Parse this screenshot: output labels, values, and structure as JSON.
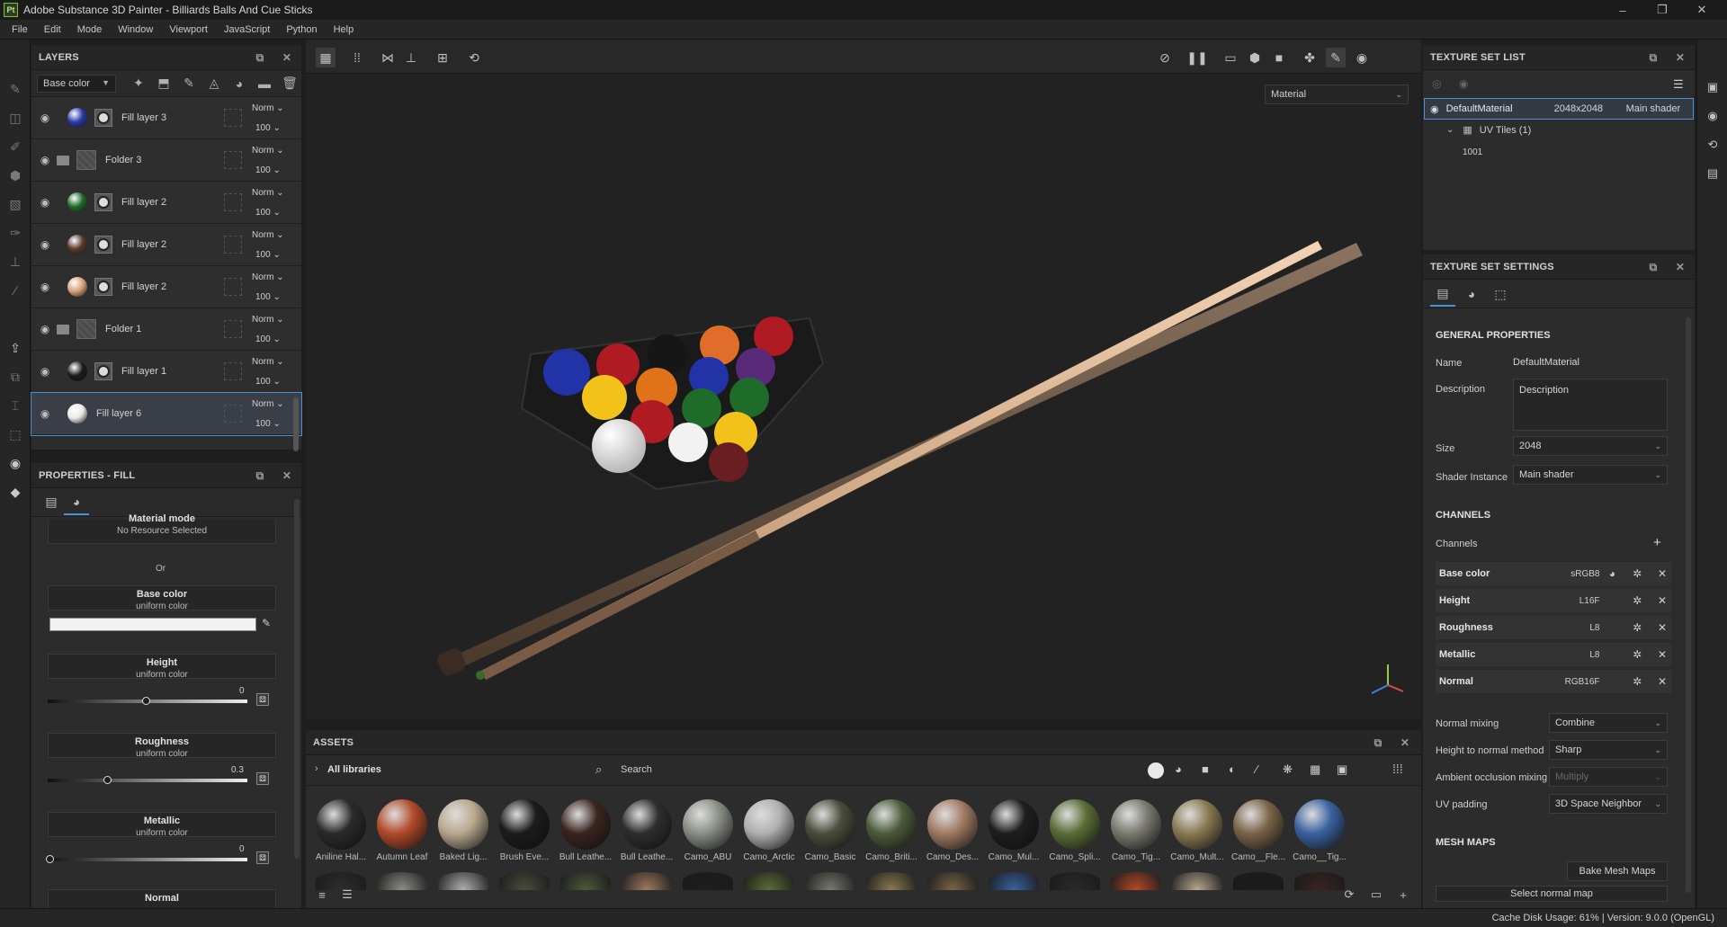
{
  "window": {
    "title": "Adobe Substance 3D Painter - Billiards Balls And Cue Sticks",
    "logo": "Pt",
    "minimize": "–",
    "maximize": "❐",
    "close": "✕"
  },
  "menu": [
    "File",
    "Edit",
    "Mode",
    "Window",
    "Viewport",
    "JavaScript",
    "Python",
    "Help"
  ],
  "layers": {
    "title": "LAYERS",
    "channel": "Base color",
    "items": [
      {
        "name": "Fill layer 3",
        "kind": "fill",
        "color": "#2a3aa8",
        "blend": "Norm",
        "opacity": "100"
      },
      {
        "name": "Folder 3",
        "kind": "folder",
        "blend": "Norm",
        "opacity": "100"
      },
      {
        "name": "Fill layer 2",
        "kind": "fill",
        "color": "#1e6b2a",
        "blend": "Norm",
        "opacity": "100"
      },
      {
        "name": "Fill layer 2",
        "kind": "fill",
        "color": "#5a3a2c",
        "blend": "Norm",
        "opacity": "100"
      },
      {
        "name": "Fill layer 2",
        "kind": "fill",
        "color": "#d8a27a",
        "blend": "Norm",
        "opacity": "100"
      },
      {
        "name": "Folder 1",
        "kind": "folder",
        "blend": "Norm",
        "opacity": "100"
      },
      {
        "name": "Fill layer 1",
        "kind": "fill",
        "color": "#1a1a1a",
        "blend": "Norm",
        "opacity": "100"
      },
      {
        "name": "Fill layer 6",
        "kind": "fill-nomask",
        "color": "#e8e8e8",
        "blend": "Norm",
        "opacity": "100",
        "selected": true
      }
    ]
  },
  "properties": {
    "title": "PROPERTIES - FILL",
    "material_mode_title": "Material mode",
    "material_mode_sub": "No Resource Selected",
    "or": "Or",
    "base_color_title": "Base color",
    "base_color_sub": "uniform color",
    "height_title": "Height",
    "height_sub": "uniform color",
    "height_value": "0",
    "roughness_title": "Roughness",
    "roughness_sub": "uniform color",
    "roughness_value": "0.3",
    "metallic_title": "Metallic",
    "metallic_sub": "uniform color",
    "metallic_value": "0",
    "normal_title": "Normal"
  },
  "viewport": {
    "material_mode": "Material"
  },
  "assets": {
    "title": "ASSETS",
    "library": "All libraries",
    "search_placeholder": "Search",
    "items": [
      {
        "label": "Aniline Hal...",
        "color": "#2a2a2a"
      },
      {
        "label": "Autumn Leaf",
        "color": "#b24a2a"
      },
      {
        "label": "Baked Lig...",
        "color": "#b8a88e"
      },
      {
        "label": "Brush Eve...",
        "color": "#1c1c1c"
      },
      {
        "label": "Bull Leathe...",
        "color": "#3a2420"
      },
      {
        "label": "Bull Leathe...",
        "color": "#2e2e2e"
      },
      {
        "label": "Camo_ABU",
        "color": "#8a8f86"
      },
      {
        "label": "Camo_Arctic",
        "color": "#b0b0b0"
      },
      {
        "label": "Camo_Basic",
        "color": "#4a4e3c"
      },
      {
        "label": "Camo_Briti...",
        "color": "#4c5a3a"
      },
      {
        "label": "Camo_Des...",
        "color": "#a07a62"
      },
      {
        "label": "Camo_Mul...",
        "color": "#1e1e1e"
      },
      {
        "label": "Camo_Spli...",
        "color": "#5a6e36"
      },
      {
        "label": "Camo_Tig...",
        "color": "#7a7a70"
      },
      {
        "label": "Camo_Mult...",
        "color": "#8a7a52"
      },
      {
        "label": "Camo__Fle...",
        "color": "#7a6448"
      },
      {
        "label": "Camo__Tig...",
        "color": "#3a62a0"
      }
    ]
  },
  "texture_set_list": {
    "title": "TEXTURE SET LIST",
    "material": "DefaultMaterial",
    "resolution": "2048x2048",
    "shader": "Main shader",
    "uv_tiles": "UV Tiles (1)",
    "tile": "1001"
  },
  "texture_set_settings": {
    "title": "TEXTURE SET SETTINGS",
    "general": "GENERAL PROPERTIES",
    "name_label": "Name",
    "name_value": "DefaultMaterial",
    "description_label": "Description",
    "description_value": "Description",
    "size_label": "Size",
    "size_value": "2048",
    "shader_label": "Shader Instance",
    "shader_value": "Main shader",
    "channels_section": "CHANNELS",
    "channels_label": "Channels",
    "channels": [
      {
        "name": "Base color",
        "format": "sRGB8"
      },
      {
        "name": "Height",
        "format": "L16F"
      },
      {
        "name": "Roughness",
        "format": "L8"
      },
      {
        "name": "Metallic",
        "format": "L8"
      },
      {
        "name": "Normal",
        "format": "RGB16F"
      }
    ],
    "normal_mixing_label": "Normal mixing",
    "normal_mixing_value": "Combine",
    "h2n_label": "Height to normal method",
    "h2n_value": "Sharp",
    "ao_label": "Ambient occlusion mixing",
    "ao_value": "Multiply",
    "uv_padding_label": "UV padding",
    "uv_padding_value": "3D Space Neighbor",
    "mesh_maps": "MESH MAPS",
    "bake_button": "Bake Mesh Maps",
    "select_normal": "Select normal map"
  },
  "status": {
    "text": "Cache Disk Usage:   61% | Version: 9.0.0 (OpenGL)"
  }
}
